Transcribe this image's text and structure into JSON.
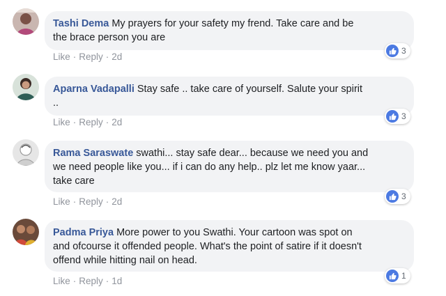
{
  "comments": [
    {
      "author": "Tashi Dema",
      "text_line1": "My prayers for your safety my frend. Take care and be",
      "text_line2": "the brace person you are",
      "text_line3": "",
      "like": "Like",
      "reply": "Reply",
      "age": "2d",
      "reactions": "3"
    },
    {
      "author": "Aparna Vadapalli",
      "text_line1": "Stay safe .. take care of yourself. Salute your spirit",
      "text_line2": "..",
      "text_line3": "",
      "like": "Like",
      "reply": "Reply",
      "age": "2d",
      "reactions": "3"
    },
    {
      "author": "Rama Saraswate",
      "text_line1": "swathi... stay safe dear... because we need you and",
      "text_line2": "we need people like you... if i can do any help.. plz let me know yaar...",
      "text_line3": "take care",
      "like": "Like",
      "reply": "Reply",
      "age": "2d",
      "reactions": "3"
    },
    {
      "author": "Padma Priya",
      "text_line1": "More power to you Swathi. Your cartoon was spot on",
      "text_line2": "and ofcourse it offended people. What's the point of satire if it doesn't",
      "text_line3": "offend while hitting nail on head.",
      "like": "Like",
      "reply": "Reply",
      "age": "1d",
      "reactions": "1"
    }
  ],
  "colors": {
    "author": "#385898",
    "bubble": "#f2f3f5",
    "meta": "#90949c",
    "like_badge": "#4c7ae2"
  },
  "icons": {
    "reaction": "thumbs-up-icon"
  }
}
